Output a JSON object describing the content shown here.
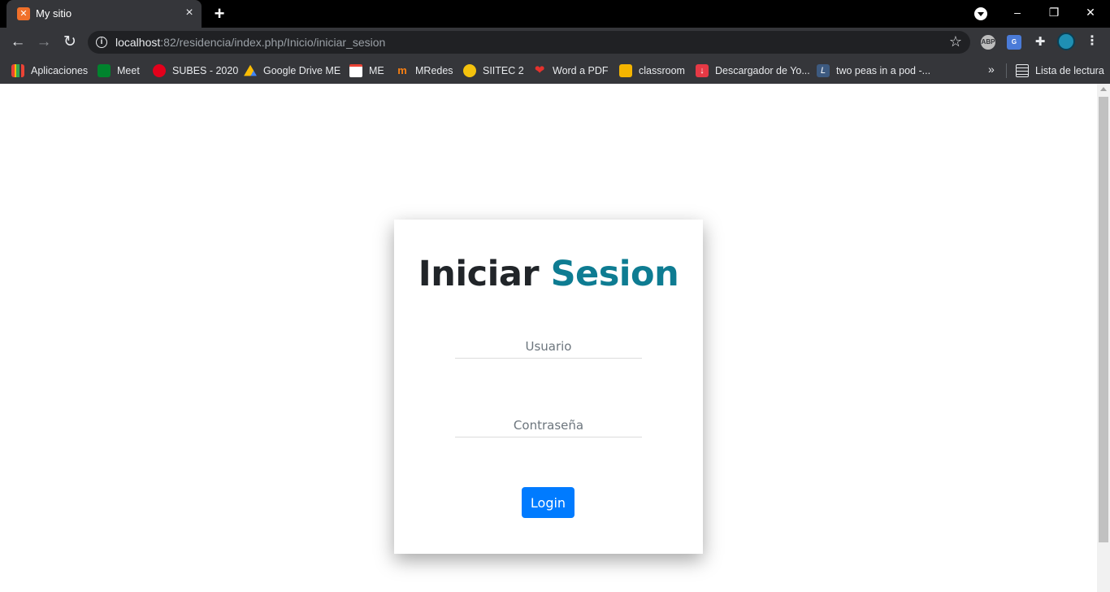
{
  "browser": {
    "tab": {
      "title": "My sitio",
      "favicon": "xampp-icon",
      "close_icon": "×"
    },
    "new_tab_icon": "+",
    "window_controls": {
      "minimize": "–",
      "restore": "❐",
      "close": "✕"
    },
    "address": {
      "host": "localhost",
      "path": ":82/residencia/index.php/Inicio/iniciar_sesion"
    },
    "extensions": {
      "abp_label": "ABP",
      "translate_label": "G"
    },
    "bookmarks": [
      {
        "label": "Aplicaciones",
        "icon": "apps-grid-icon",
        "color": "#ea4335"
      },
      {
        "label": "Meet",
        "icon": "meet-icon",
        "color": "#00832d"
      },
      {
        "label": "SUBES - 2020",
        "icon": "subes-icon",
        "color": "#e3001b"
      },
      {
        "label": "Google Drive ME",
        "icon": "drive-icon",
        "color": "#fbbc04"
      },
      {
        "label": "ME",
        "icon": "gmail-icon",
        "color": "#ea4335"
      },
      {
        "label": "MRedes",
        "icon": "moodle-icon",
        "color": "#f98012"
      },
      {
        "label": "SIITEC 2",
        "icon": "siitec-icon",
        "color": "#f4c20d"
      },
      {
        "label": "Word a PDF",
        "icon": "heart-icon",
        "color": "#e5322d"
      },
      {
        "label": "classroom",
        "icon": "classroom-icon",
        "color": "#f4b400"
      },
      {
        "label": "Descargador de Yo...",
        "icon": "download-icon",
        "color": "#e53945"
      },
      {
        "label": "two peas in a pod -...",
        "icon": "dictionary-icon",
        "color": "#3d5a80"
      }
    ],
    "overflow_label": "»",
    "reading_list": "Lista de lectura"
  },
  "login": {
    "title_main": "Iniciar",
    "title_accent": "Sesion",
    "username_placeholder": "Usuario",
    "password_placeholder": "Contraseña",
    "submit_label": "Login"
  }
}
